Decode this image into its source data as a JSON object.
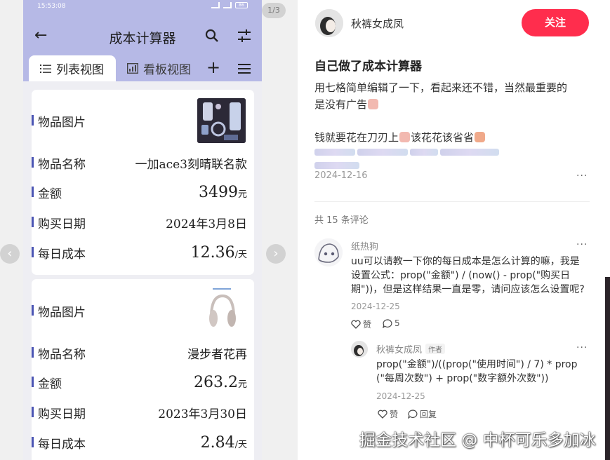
{
  "phone": {
    "status_time": "15:53:08",
    "status_battery": "86",
    "title": "成本计算器",
    "tab_list": "列表视图",
    "tab_kanban": "看板视图"
  },
  "records": [
    {
      "image_label": "物品图片",
      "name_label": "物品名称",
      "name_value": "一加ace3刻晴联名款",
      "amount_label": "金额",
      "amount_value": "3499",
      "amount_unit": "元",
      "date_label": "购买日期",
      "date_value": "2024年3月8日",
      "daily_label": "每日成本",
      "daily_value": "12.36",
      "daily_unit": "/天"
    },
    {
      "image_label": "物品图片",
      "name_label": "物品名称",
      "name_value": "漫步者花再",
      "amount_label": "金额",
      "amount_value": "263.2",
      "amount_unit": "元",
      "date_label": "购买日期",
      "date_value": "2023年3月30日",
      "daily_label": "每日成本",
      "daily_value": "2.84",
      "daily_unit": "/天"
    }
  ],
  "media": {
    "counter": "1/3"
  },
  "post": {
    "author": "秋裤女成凤",
    "follow_label": "关注",
    "title": "自己做了成本计算器",
    "line1": "用七格简单编辑了一下，看起来还不错，当然最重要的",
    "line2": "是没有广告",
    "line3a": "钱就要花在刀刃上",
    "line3b": "该花花该省省",
    "date": "2024-12-16",
    "more": "···"
  },
  "comments": {
    "count_text": "共 15 条评论",
    "items": [
      {
        "name": "纸热狗",
        "text_lines": [
          "uu可以请教一下你的每日成本是怎么计算的嘛，我是",
          "设置公式：prop(\"金额\") / (now() - prop(\"购买日",
          "期\"))，但是这样结果一直是零，请问应该怎么设置呢?"
        ],
        "date": "2024-12-25",
        "like_label": "赞",
        "reply_count": "5",
        "more": "···"
      },
      {
        "name": "秋裤女成凤",
        "tag": "作者",
        "text_lines": [
          "prop(\"金额\")/((prop(\"使用时间\") / 7) * prop",
          "(\"每周次数\") + prop(\"数字额外次数\"))"
        ],
        "date": "2024-12-25",
        "like_label": "赞",
        "reply_label": "回复",
        "more": "···"
      }
    ]
  },
  "watermark": "掘金技术社区 @ 中杯可乐多加冰",
  "colors": {
    "header": "#b6b9e6",
    "accent_bar": "#4b55b4",
    "follow": "#ff2d4d"
  }
}
